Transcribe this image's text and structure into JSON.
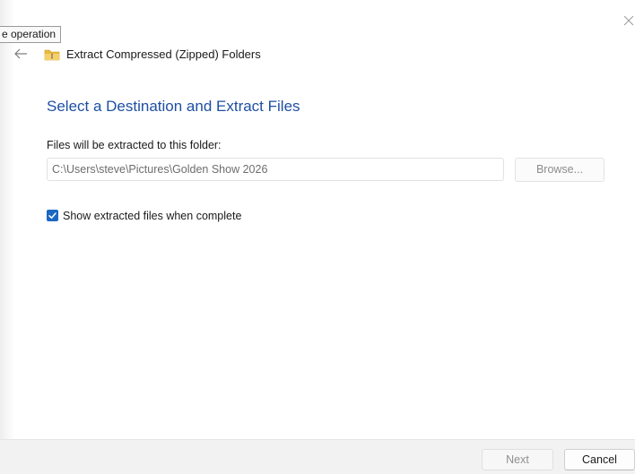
{
  "tooltip": {
    "text": "e operation"
  },
  "header": {
    "back_icon": "back-arrow-icon",
    "folder_icon": "zipped-folder-icon",
    "title": "Extract Compressed (Zipped) Folders",
    "close_icon": "close-icon"
  },
  "main": {
    "heading": "Select a Destination and Extract Files",
    "destination_label": "Files will be extracted to this folder:",
    "destination_value": "C:\\Users\\steve\\Pictures\\Golden Show 2026",
    "browse_label": "Browse...",
    "show_files_checked": true,
    "show_files_label": "Show extracted files when complete"
  },
  "footer": {
    "next_label": "Next",
    "cancel_label": "Cancel"
  },
  "colors": {
    "heading": "#1e4fa3",
    "checkbox": "#1a68c2",
    "footer_bg": "#f2f2f2",
    "folder_yellow": "#e9b93c"
  }
}
